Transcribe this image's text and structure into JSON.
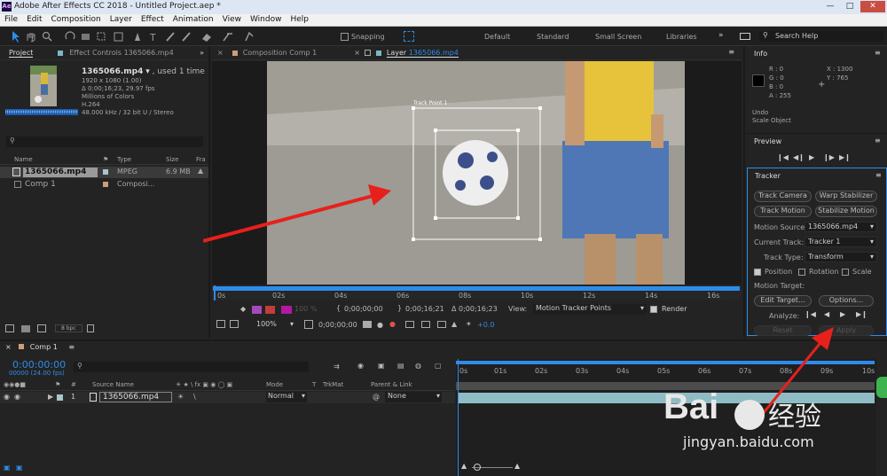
{
  "app": {
    "title": "Adobe After Effects CC 2018 - Untitled Project.aep *",
    "icon": "Ae"
  },
  "menu": [
    "File",
    "Edit",
    "Composition",
    "Layer",
    "Effect",
    "Animation",
    "View",
    "Window",
    "Help"
  ],
  "toolbar": {
    "snapping": "Snapping",
    "workspaces": [
      "Default",
      "Standard",
      "Small Screen",
      "Libraries"
    ],
    "search_help": "Search Help"
  },
  "project": {
    "tab": "Project",
    "effect_tab": "Effect Controls 1365066.mp4",
    "file_name": "1365066.mp4",
    "used": ", used 1 time",
    "info_lines": [
      "1920 x 1080 (1.00)",
      "Δ 0;00;16;23, 29.97 fps",
      "Millions of Colors",
      "H.264",
      "48.000 kHz / 32 bit U / Stereo"
    ],
    "columns": [
      "Name",
      "Type",
      "Size",
      "Fra"
    ],
    "items": [
      {
        "name": "1365066.mp4",
        "type": "MPEG",
        "size": "6.9 MB"
      },
      {
        "name": "Comp 1",
        "type": "Composi...",
        "size": ""
      }
    ],
    "bpc": "8 bpc"
  },
  "viewer": {
    "comp_tab": "Composition Comp 1",
    "layer_tab_prefix": "Layer ",
    "layer_tab_name": "1365066.mp4",
    "track_point": "Track Point 1",
    "ruler": [
      "0s",
      "02s",
      "04s",
      "06s",
      "08s",
      "10s",
      "12s",
      "14s",
      "16s"
    ],
    "time_in": "0;00;00;00",
    "time_out": "0;00;16;21",
    "duration": "Δ 0;00;16;23",
    "view_label": "View:",
    "view_value": "Motion Tracker Points",
    "render": "Render",
    "zoom": "100%",
    "current_time": "0;00;00;00",
    "exposure": "+0.0",
    "pct": "100 %"
  },
  "info": {
    "title": "Info",
    "r": "R : 0",
    "g": "G : 0",
    "b": "B : 0",
    "a": "A : 255",
    "x": "X : 1300",
    "y": "Y : 765",
    "undo": "Undo",
    "scale": "Scale Object"
  },
  "preview": {
    "title": "Preview"
  },
  "tracker": {
    "title": "Tracker",
    "track_camera": "Track Camera",
    "warp_stabilizer": "Warp Stabilizer",
    "track_motion": "Track Motion",
    "stabilize_motion": "Stabilize Motion",
    "motion_source_label": "Motion Source:",
    "motion_source": "1365066.mp4",
    "current_track_label": "Current Track:",
    "current_track": "Tracker 1",
    "track_type_label": "Track Type:",
    "track_type": "Transform",
    "position": "Position",
    "rotation": "Rotation",
    "scale": "Scale",
    "motion_target": "Motion Target:",
    "edit_target": "Edit Target...",
    "options": "Options...",
    "analyze": "Analyze:",
    "reset": "Reset",
    "apply": "Apply"
  },
  "timeline": {
    "comp_tab": "Comp 1",
    "timecode": "0:00:00:00",
    "fps": "00000 (24.00 fps)",
    "col_source": "Source Name",
    "col_mode": "Mode",
    "col_t": "T",
    "col_trkmat": "TrkMat",
    "col_parent": "Parent & Link",
    "layer_num": "1",
    "layer_name": "1365066.mp4",
    "mode": "Normal",
    "parent": "None",
    "ruler": [
      "0s",
      "01s",
      "02s",
      "03s",
      "04s",
      "05s",
      "06s",
      "07s",
      "08s",
      "09s",
      "10s"
    ]
  },
  "watermark": {
    "brand": "Bai",
    "brand2": "经验",
    "url": "jingyan.baidu.com"
  },
  "colors": {
    "accent": "#2d8ceb",
    "arrow": "#e8201c",
    "bg": "#232323"
  }
}
